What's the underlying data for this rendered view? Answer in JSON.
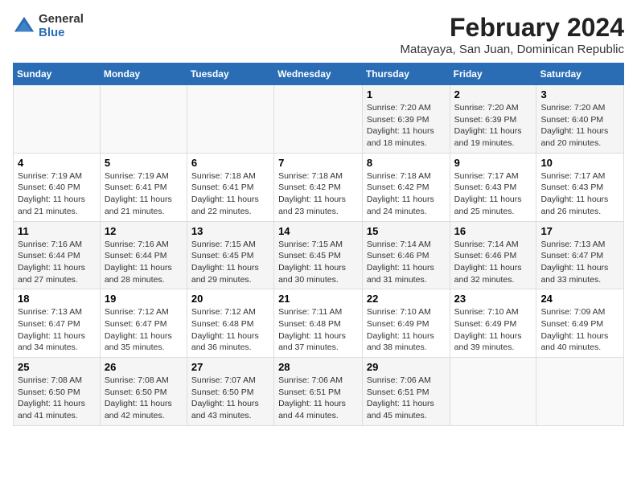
{
  "logo": {
    "general": "General",
    "blue": "Blue"
  },
  "title": "February 2024",
  "subtitle": "Matayaya, San Juan, Dominican Republic",
  "days_of_week": [
    "Sunday",
    "Monday",
    "Tuesday",
    "Wednesday",
    "Thursday",
    "Friday",
    "Saturday"
  ],
  "weeks": [
    [
      {
        "day": "",
        "info": ""
      },
      {
        "day": "",
        "info": ""
      },
      {
        "day": "",
        "info": ""
      },
      {
        "day": "",
        "info": ""
      },
      {
        "day": "1",
        "info": "Sunrise: 7:20 AM\nSunset: 6:39 PM\nDaylight: 11 hours and 18 minutes."
      },
      {
        "day": "2",
        "info": "Sunrise: 7:20 AM\nSunset: 6:39 PM\nDaylight: 11 hours and 19 minutes."
      },
      {
        "day": "3",
        "info": "Sunrise: 7:20 AM\nSunset: 6:40 PM\nDaylight: 11 hours and 20 minutes."
      }
    ],
    [
      {
        "day": "4",
        "info": "Sunrise: 7:19 AM\nSunset: 6:40 PM\nDaylight: 11 hours and 21 minutes."
      },
      {
        "day": "5",
        "info": "Sunrise: 7:19 AM\nSunset: 6:41 PM\nDaylight: 11 hours and 21 minutes."
      },
      {
        "day": "6",
        "info": "Sunrise: 7:18 AM\nSunset: 6:41 PM\nDaylight: 11 hours and 22 minutes."
      },
      {
        "day": "7",
        "info": "Sunrise: 7:18 AM\nSunset: 6:42 PM\nDaylight: 11 hours and 23 minutes."
      },
      {
        "day": "8",
        "info": "Sunrise: 7:18 AM\nSunset: 6:42 PM\nDaylight: 11 hours and 24 minutes."
      },
      {
        "day": "9",
        "info": "Sunrise: 7:17 AM\nSunset: 6:43 PM\nDaylight: 11 hours and 25 minutes."
      },
      {
        "day": "10",
        "info": "Sunrise: 7:17 AM\nSunset: 6:43 PM\nDaylight: 11 hours and 26 minutes."
      }
    ],
    [
      {
        "day": "11",
        "info": "Sunrise: 7:16 AM\nSunset: 6:44 PM\nDaylight: 11 hours and 27 minutes."
      },
      {
        "day": "12",
        "info": "Sunrise: 7:16 AM\nSunset: 6:44 PM\nDaylight: 11 hours and 28 minutes."
      },
      {
        "day": "13",
        "info": "Sunrise: 7:15 AM\nSunset: 6:45 PM\nDaylight: 11 hours and 29 minutes."
      },
      {
        "day": "14",
        "info": "Sunrise: 7:15 AM\nSunset: 6:45 PM\nDaylight: 11 hours and 30 minutes."
      },
      {
        "day": "15",
        "info": "Sunrise: 7:14 AM\nSunset: 6:46 PM\nDaylight: 11 hours and 31 minutes."
      },
      {
        "day": "16",
        "info": "Sunrise: 7:14 AM\nSunset: 6:46 PM\nDaylight: 11 hours and 32 minutes."
      },
      {
        "day": "17",
        "info": "Sunrise: 7:13 AM\nSunset: 6:47 PM\nDaylight: 11 hours and 33 minutes."
      }
    ],
    [
      {
        "day": "18",
        "info": "Sunrise: 7:13 AM\nSunset: 6:47 PM\nDaylight: 11 hours and 34 minutes."
      },
      {
        "day": "19",
        "info": "Sunrise: 7:12 AM\nSunset: 6:47 PM\nDaylight: 11 hours and 35 minutes."
      },
      {
        "day": "20",
        "info": "Sunrise: 7:12 AM\nSunset: 6:48 PM\nDaylight: 11 hours and 36 minutes."
      },
      {
        "day": "21",
        "info": "Sunrise: 7:11 AM\nSunset: 6:48 PM\nDaylight: 11 hours and 37 minutes."
      },
      {
        "day": "22",
        "info": "Sunrise: 7:10 AM\nSunset: 6:49 PM\nDaylight: 11 hours and 38 minutes."
      },
      {
        "day": "23",
        "info": "Sunrise: 7:10 AM\nSunset: 6:49 PM\nDaylight: 11 hours and 39 minutes."
      },
      {
        "day": "24",
        "info": "Sunrise: 7:09 AM\nSunset: 6:49 PM\nDaylight: 11 hours and 40 minutes."
      }
    ],
    [
      {
        "day": "25",
        "info": "Sunrise: 7:08 AM\nSunset: 6:50 PM\nDaylight: 11 hours and 41 minutes."
      },
      {
        "day": "26",
        "info": "Sunrise: 7:08 AM\nSunset: 6:50 PM\nDaylight: 11 hours and 42 minutes."
      },
      {
        "day": "27",
        "info": "Sunrise: 7:07 AM\nSunset: 6:50 PM\nDaylight: 11 hours and 43 minutes."
      },
      {
        "day": "28",
        "info": "Sunrise: 7:06 AM\nSunset: 6:51 PM\nDaylight: 11 hours and 44 minutes."
      },
      {
        "day": "29",
        "info": "Sunrise: 7:06 AM\nSunset: 6:51 PM\nDaylight: 11 hours and 45 minutes."
      },
      {
        "day": "",
        "info": ""
      },
      {
        "day": "",
        "info": ""
      }
    ]
  ]
}
